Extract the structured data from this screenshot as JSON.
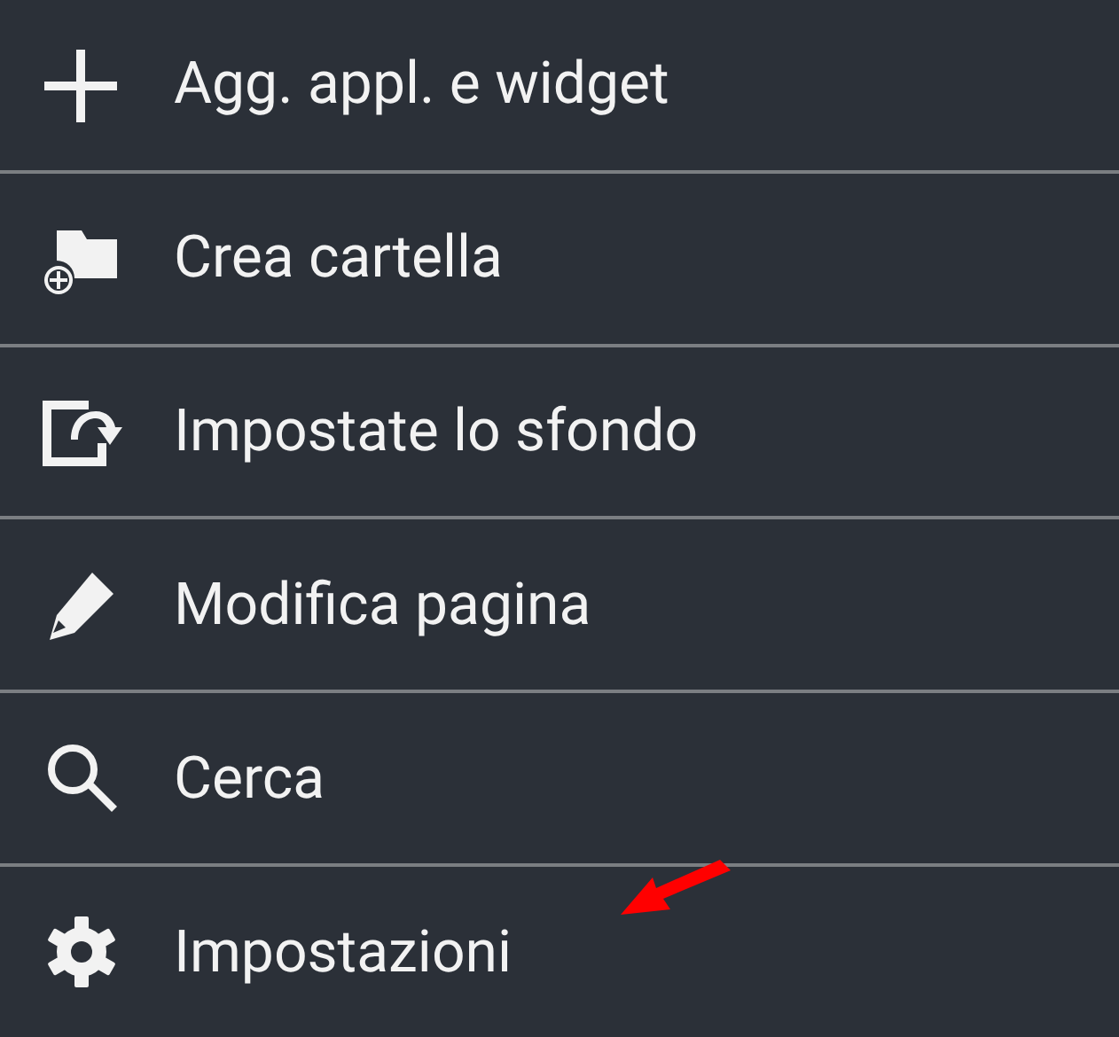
{
  "menu": {
    "items": [
      {
        "label": "Agg. appl. e widget"
      },
      {
        "label": "Crea cartella"
      },
      {
        "label": "Impostate lo sfondo"
      },
      {
        "label": "Modifica pagina"
      },
      {
        "label": "Cerca"
      },
      {
        "label": "Impostazioni"
      }
    ]
  }
}
